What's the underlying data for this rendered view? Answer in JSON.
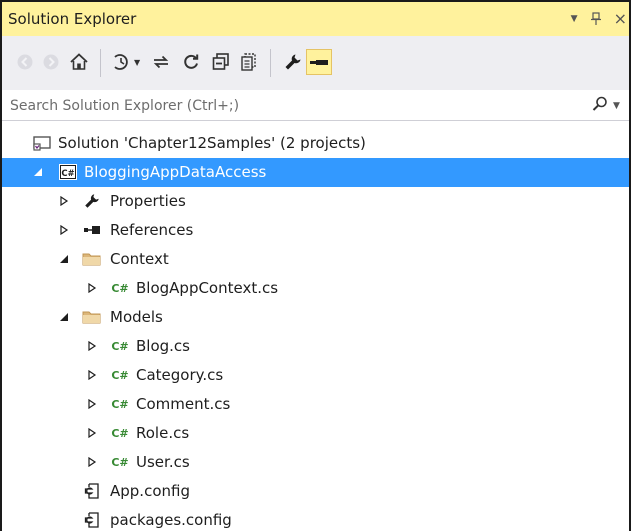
{
  "panel": {
    "title": "Solution Explorer",
    "dropdown_glyph": "▼",
    "pin_glyph": "ᛣ",
    "close_glyph": "×"
  },
  "toolbar": {
    "buttons": [
      {
        "name": "back-button",
        "icon": "back-arrow-icon",
        "enabled": false
      },
      {
        "name": "forward-button",
        "icon": "forward-arrow-icon",
        "enabled": false
      },
      {
        "name": "home-button",
        "icon": "home-icon",
        "enabled": true
      },
      {
        "name": "pending-changes-filter-button",
        "icon": "clock-filter-icon",
        "enabled": true
      },
      {
        "name": "sync-with-document-button",
        "icon": "sync-arrows-icon",
        "enabled": true
      },
      {
        "name": "refresh-button",
        "icon": "refresh-icon",
        "enabled": true
      },
      {
        "name": "collapse-all-button",
        "icon": "collapse-all-icon",
        "enabled": true
      },
      {
        "name": "show-all-files-button",
        "icon": "show-all-files-icon",
        "enabled": true
      },
      {
        "name": "properties-button",
        "icon": "wrench-icon",
        "enabled": true
      },
      {
        "name": "preview-selected-items-button",
        "icon": "preview-icon",
        "enabled": true,
        "active": true
      }
    ]
  },
  "search": {
    "placeholder": "Search Solution Explorer (Ctrl+;)",
    "value": ""
  },
  "tree": {
    "solution": {
      "label": "Solution 'Chapter12Samples' (2 projects)",
      "icon": "solution-icon"
    },
    "project": {
      "label": "BloggingAppDataAccess",
      "icon": "csharp-project-icon",
      "expanded": true,
      "selected": true
    },
    "items": {
      "properties": {
        "label": "Properties",
        "icon": "wrench-icon",
        "expanded": false
      },
      "references": {
        "label": "References",
        "icon": "references-icon",
        "expanded": false
      },
      "context_folder": {
        "label": "Context",
        "icon": "folder-icon",
        "expanded": true
      },
      "blogappcontext": {
        "label": "BlogAppContext.cs",
        "icon": "csharp-file-icon",
        "expanded": false
      },
      "models_folder": {
        "label": "Models",
        "icon": "folder-icon",
        "expanded": true
      },
      "blog": {
        "label": "Blog.cs",
        "icon": "csharp-file-icon",
        "expanded": false
      },
      "category": {
        "label": "Category.cs",
        "icon": "csharp-file-icon",
        "expanded": false
      },
      "comment": {
        "label": "Comment.cs",
        "icon": "csharp-file-icon",
        "expanded": false
      },
      "role": {
        "label": "Role.cs",
        "icon": "csharp-file-icon",
        "expanded": false
      },
      "user": {
        "label": "User.cs",
        "icon": "csharp-file-icon",
        "expanded": false
      },
      "app_config": {
        "label": "App.config",
        "icon": "config-file-icon"
      },
      "packages_config": {
        "label": "packages.config",
        "icon": "config-file-icon"
      }
    },
    "cs_badge": "C#"
  },
  "colors": {
    "title_bar": "#fff29d",
    "toolbar": "#eeeef2",
    "selection": "#3399ff",
    "csharp_green": "#388a34"
  }
}
